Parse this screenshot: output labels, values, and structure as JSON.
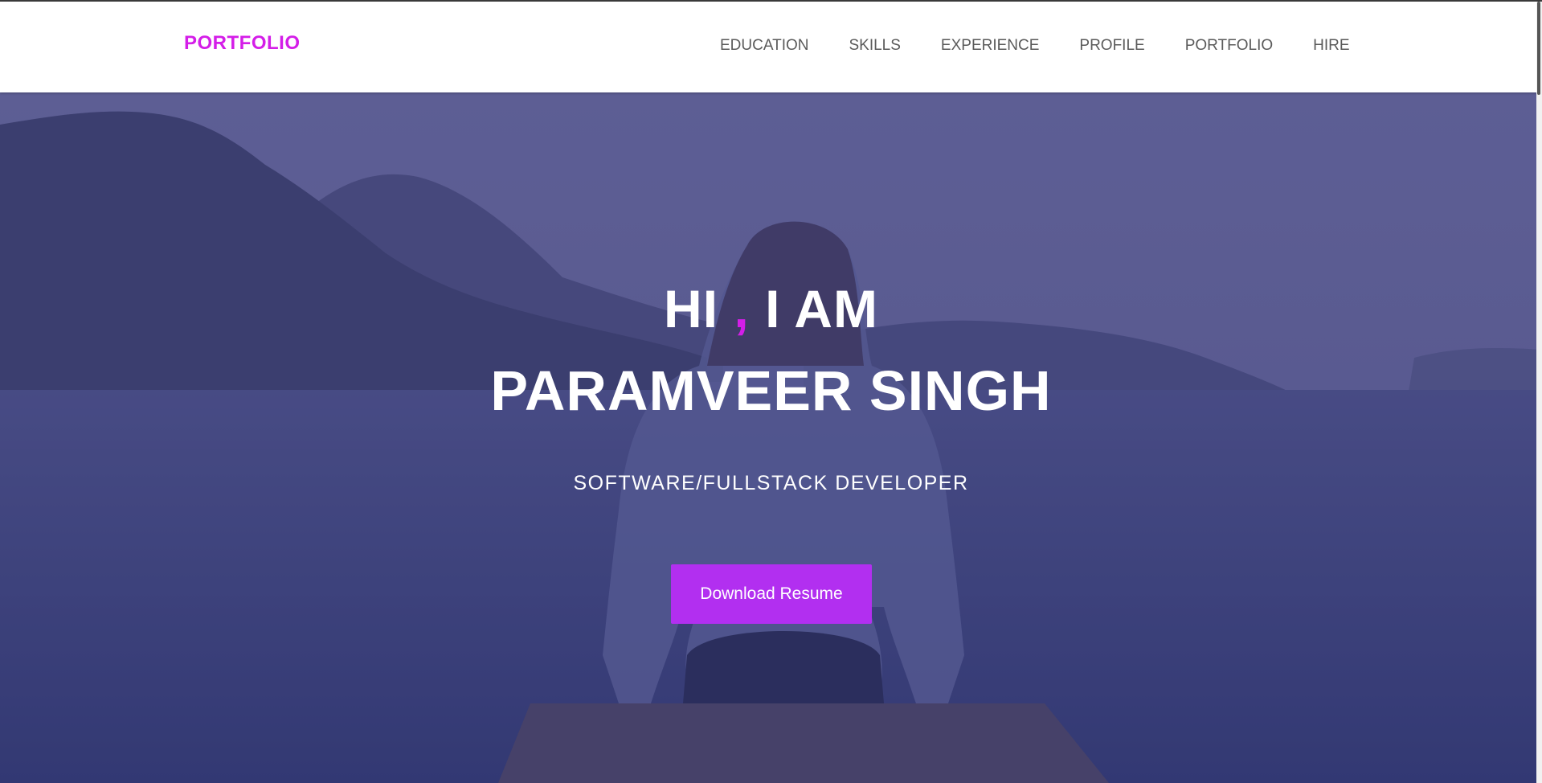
{
  "navbar": {
    "brand": "PORTFOLIO",
    "links": [
      {
        "label": "EDUCATION"
      },
      {
        "label": "SKILLS"
      },
      {
        "label": "EXPERIENCE"
      },
      {
        "label": "PROFILE"
      },
      {
        "label": "PORTFOLIO"
      },
      {
        "label": "HIRE"
      }
    ]
  },
  "hero": {
    "greeting_hi": "HI",
    "greeting_comma": ",",
    "greeting_rest": "I AM",
    "name": "PARAMVEER SINGH",
    "role": "SOFTWARE/FULLSTACK DEVELOPER",
    "button_label": "Download Resume"
  },
  "colors": {
    "accent": "#d41ee8",
    "button": "#b22ff0",
    "nav_text": "#5a5a5a",
    "hero_overlay": "#5a5e8e"
  }
}
